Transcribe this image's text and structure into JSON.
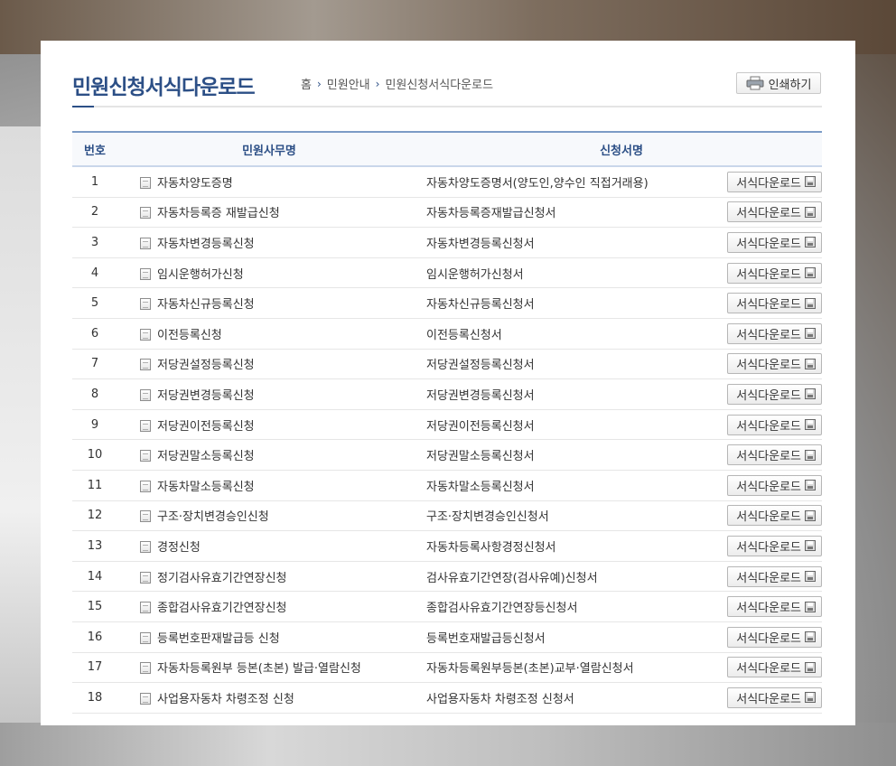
{
  "page": {
    "title": "민원신청서식다운로드",
    "print_label": "인쇄하기"
  },
  "breadcrumb": [
    "홈",
    "민원안내",
    "민원신청서식다운로드"
  ],
  "table": {
    "headers": {
      "no": "번호",
      "name": "민원사무명",
      "form": "신청서명"
    },
    "download_label": "서식다운로드",
    "rows": [
      {
        "no": "1",
        "name": "자동차양도증명",
        "form": "자동차양도증명서(양도인,양수인 직접거래용)"
      },
      {
        "no": "2",
        "name": "자동차등록증 재발급신청",
        "form": "자동차등록증재발급신청서"
      },
      {
        "no": "3",
        "name": "자동차변경등록신청",
        "form": "자동차변경등록신청서"
      },
      {
        "no": "4",
        "name": "임시운행허가신청",
        "form": "임시운행허가신청서"
      },
      {
        "no": "5",
        "name": "자동차신규등록신청",
        "form": "자동차신규등록신청서"
      },
      {
        "no": "6",
        "name": "이전등록신청",
        "form": "이전등록신청서"
      },
      {
        "no": "7",
        "name": "저당권설정등록신청",
        "form": "저당권설정등록신청서"
      },
      {
        "no": "8",
        "name": "저당권변경등록신청",
        "form": "저당권변경등록신청서"
      },
      {
        "no": "9",
        "name": "저당권이전등록신청",
        "form": "저당권이전등록신청서"
      },
      {
        "no": "10",
        "name": "저당권말소등록신청",
        "form": "저당권말소등록신청서"
      },
      {
        "no": "11",
        "name": "자동차말소등록신청",
        "form": "자동차말소등록신청서"
      },
      {
        "no": "12",
        "name": "구조·장치변경승인신청",
        "form": "구조·장치변경승인신청서"
      },
      {
        "no": "13",
        "name": "경정신청",
        "form": "자동차등록사항경정신청서"
      },
      {
        "no": "14",
        "name": "정기검사유효기간연장신청",
        "form": "검사유효기간연장(검사유예)신청서"
      },
      {
        "no": "15",
        "name": "종합검사유효기간연장신청",
        "form": "종합검사유효기간연장등신청서"
      },
      {
        "no": "16",
        "name": "등록번호판재발급등 신청",
        "form": "등록번호재발급등신청서"
      },
      {
        "no": "17",
        "name": "자동차등록원부 등본(초본) 발급·열람신청",
        "form": "자동차등록원부등본(초본)교부·열람신청서"
      },
      {
        "no": "18",
        "name": "사업용자동차 차령조정 신청",
        "form": "사업용자동차 차령조정 신청서"
      }
    ]
  }
}
